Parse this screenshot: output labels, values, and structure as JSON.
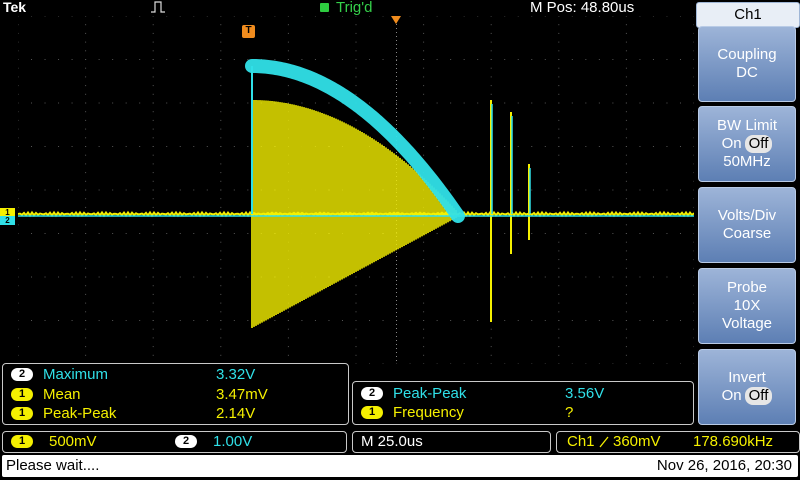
{
  "header": {
    "brand": "Tek",
    "trigger_status": "Trig'd",
    "m_pos": "M Pos: 48.80us"
  },
  "markers": {
    "trigger": "T",
    "ch1": "1",
    "ch2": "2"
  },
  "measurements_left": [
    {
      "channel": "2",
      "label": "Maximum",
      "value": "3.32V"
    },
    {
      "channel": "1",
      "label": "Mean",
      "value": "3.47mV"
    },
    {
      "channel": "1",
      "label": "Peak-Peak",
      "value": "2.14V"
    }
  ],
  "measurements_right": [
    {
      "channel": "2",
      "label": "Peak-Peak",
      "value": "3.56V"
    },
    {
      "channel": "1",
      "label": "Frequency",
      "value": "?"
    }
  ],
  "status_bar": {
    "ch1_channel": "1",
    "ch1_scale": "500mV",
    "ch2_channel": "2",
    "ch2_scale": "1.00V",
    "timebase": "M 25.0us",
    "trigger_source": "Ch1",
    "trigger_level": "360mV",
    "trigger_freq": "178.690kHz"
  },
  "message": {
    "text": "Please wait....",
    "datetime": "Nov 26, 2016, 20:30"
  },
  "side_menu": {
    "title": "Ch1",
    "coupling": {
      "line1": "Coupling",
      "line2": "DC"
    },
    "bw_limit": {
      "line1": "BW Limit",
      "on": "On",
      "off": "Off",
      "line3": "50MHz"
    },
    "volts_div": {
      "line1": "Volts/Div",
      "line2": "Coarse"
    },
    "probe": {
      "line1": "Probe",
      "line2": "10X",
      "line3": "Voltage"
    },
    "invert": {
      "line1": "Invert",
      "on": "On",
      "off": "Off"
    }
  },
  "colors": {
    "ch1": "#f5f000",
    "ch2": "#30e0e8",
    "trigger": "#f08c1e",
    "menu_button": "#7a98c8"
  }
}
